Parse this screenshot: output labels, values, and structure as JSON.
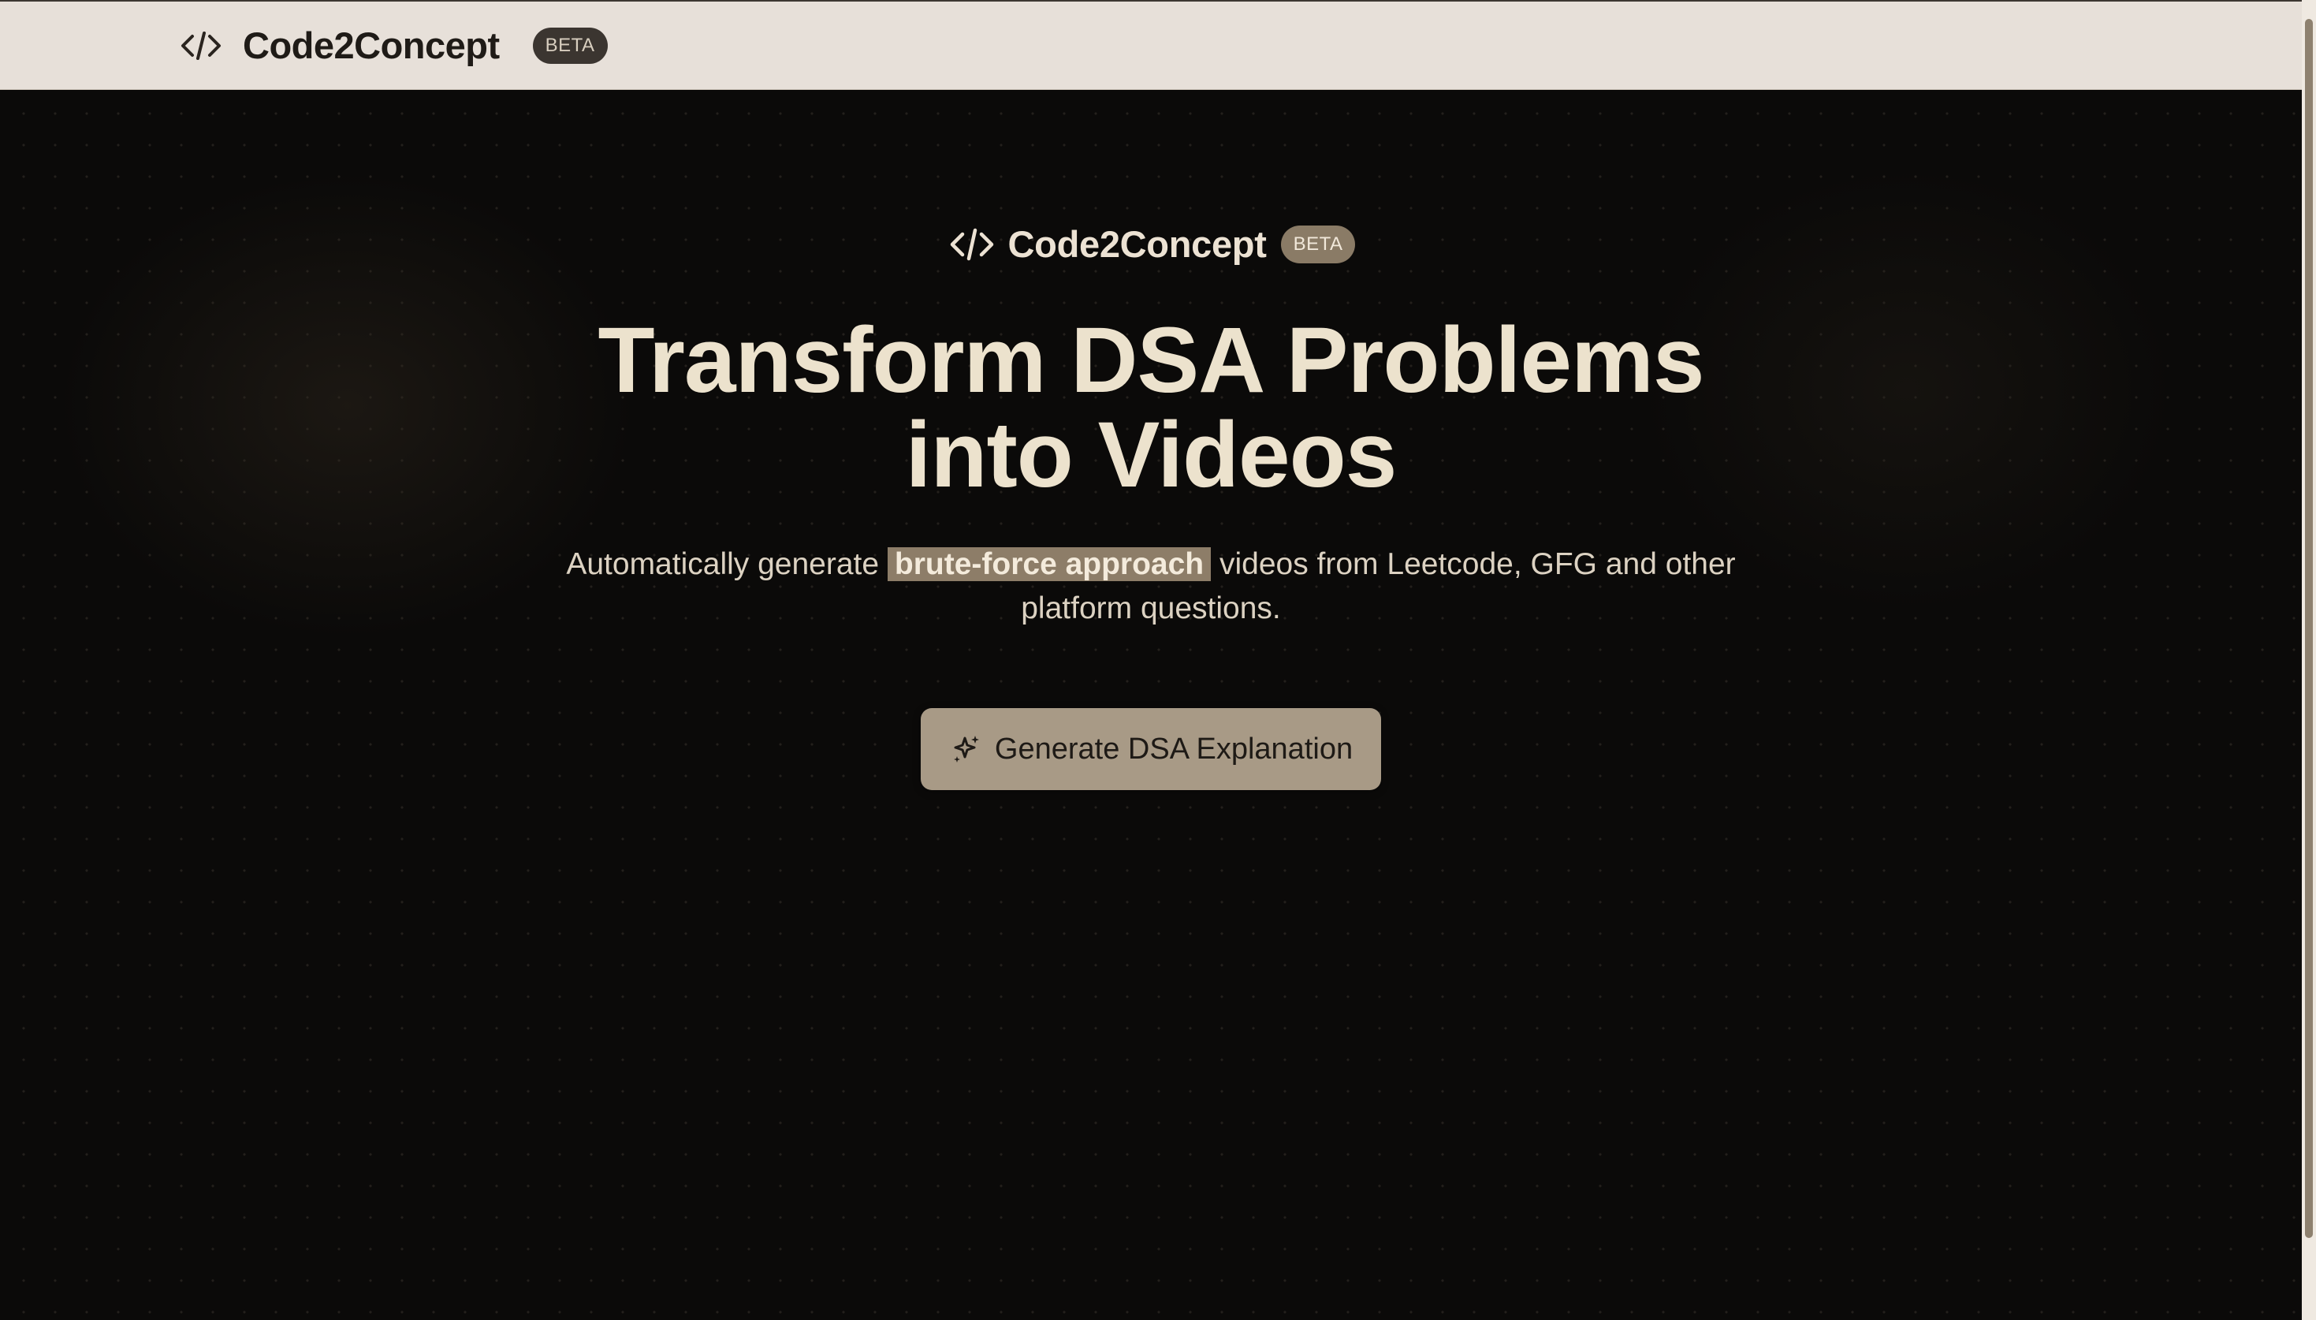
{
  "navbar": {
    "logo_icon": "code-brackets-icon",
    "title": "Code2Concept",
    "badge": "BETA"
  },
  "hero": {
    "brand": {
      "logo_icon": "code-brackets-icon",
      "title": "Code2Concept",
      "badge": "BETA"
    },
    "headline_line1": "Transform DSA Problems",
    "headline_line2": "into Videos",
    "subtitle": {
      "before": "Automatically generate ",
      "highlight": "brute-force approach",
      "after": " videos from Leetcode, GFG and other platform questions."
    },
    "cta": {
      "icon": "sparkles-icon",
      "label": "Generate DSA Explanation"
    }
  },
  "colors": {
    "navbar_bg": "#e7e0d9",
    "page_bg": "#0b0a09",
    "headline": "#ece2cd",
    "accent": "#a89a86",
    "highlight_bg": "#8d7d68"
  }
}
